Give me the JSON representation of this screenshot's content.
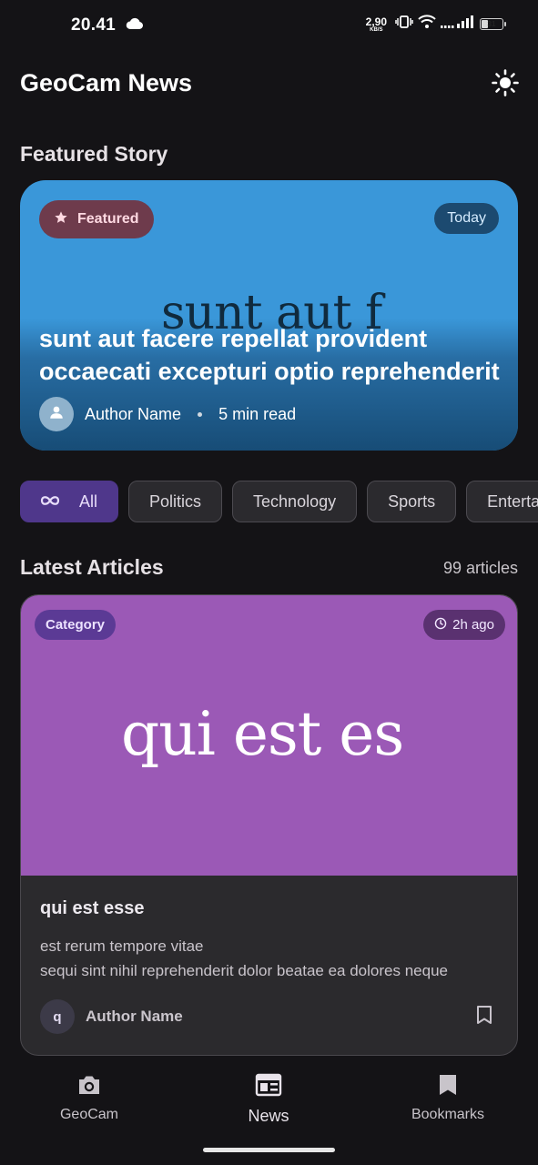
{
  "status_bar": {
    "time": "20.41",
    "net_speed_value": "2,90",
    "net_speed_unit": "KB/S",
    "battery_level": "31",
    "icons": [
      "cloud-icon",
      "vibrate-icon",
      "wifi-icon",
      "signal-icon",
      "battery-icon"
    ]
  },
  "app_bar": {
    "title": "GeoCam News",
    "theme_icon": "sun-icon"
  },
  "featured": {
    "section_title": "Featured Story",
    "badge_label": "Featured",
    "date_label": "Today",
    "image_text": "sunt aut f",
    "headline_line1": "sunt aut facere repellat provident",
    "headline_line2": "occaecati excepturi optio reprehenderit",
    "author": "Author Name",
    "read_time": "5 min read",
    "colors": {
      "card_bg": "#3a97d9",
      "badge_bg": "#6e3b4c"
    }
  },
  "categories": {
    "chips": [
      {
        "label": "All",
        "active": true,
        "icon": "infinity-icon"
      },
      {
        "label": "Politics",
        "active": false
      },
      {
        "label": "Technology",
        "active": false
      },
      {
        "label": "Sports",
        "active": false
      },
      {
        "label": "Entertainment",
        "active": false
      }
    ],
    "colors": {
      "active_bg": "#4f378b"
    }
  },
  "latest": {
    "section_title": "Latest Articles",
    "count_label": "99 articles",
    "articles": [
      {
        "category": "Category",
        "time_ago": "2h ago",
        "image_text": "qui est es",
        "title": "qui est esse",
        "excerpt_line1": "est rerum tempore vitae",
        "excerpt_line2": "sequi sint nihil reprehenderit dolor beatae ea dolores neque",
        "author_initial": "q",
        "author": "Author Name",
        "image_color": "#9b59b6"
      }
    ]
  },
  "bottom_nav": {
    "items": [
      {
        "label": "GeoCam",
        "icon": "camera-icon",
        "active": false
      },
      {
        "label": "News",
        "icon": "newspaper-icon",
        "active": true
      },
      {
        "label": "Bookmarks",
        "icon": "bookmark-icon",
        "active": false
      }
    ]
  }
}
